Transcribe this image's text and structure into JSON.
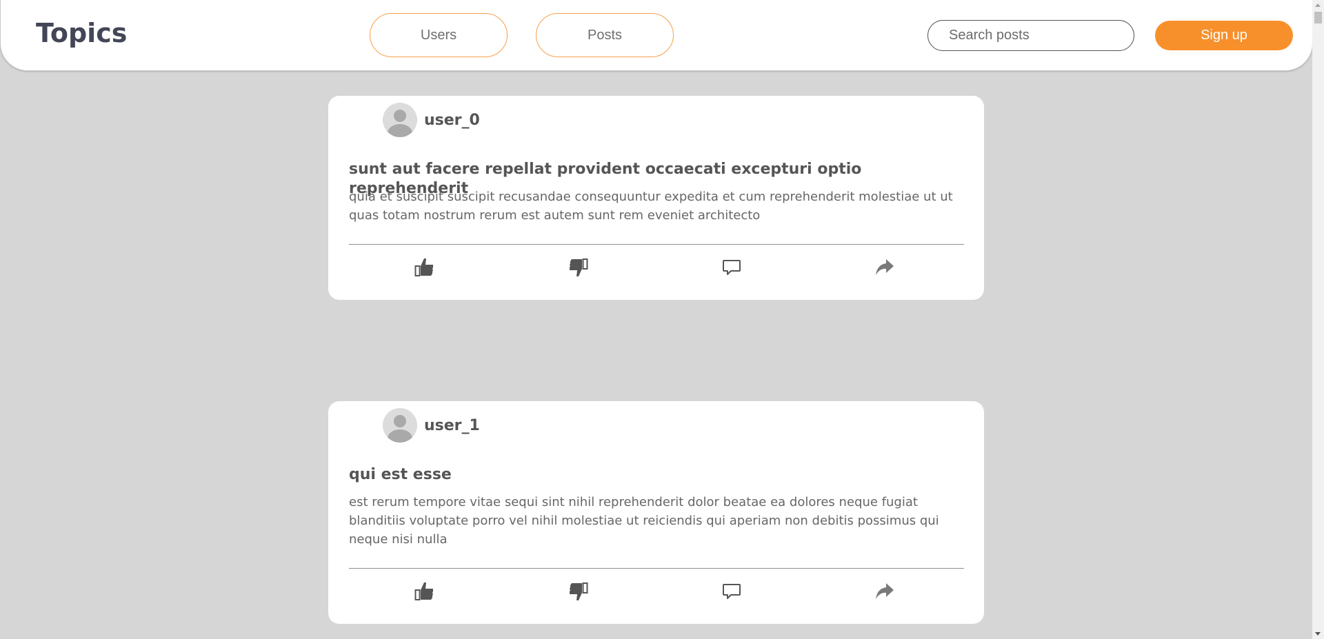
{
  "header": {
    "logo": "Topics",
    "nav": {
      "users_label": "Users",
      "posts_label": "Posts"
    },
    "search": {
      "placeholder": "Search posts",
      "value": ""
    },
    "signup_label": "Sign up"
  },
  "posts": [
    {
      "username": "user_0",
      "title": "sunt aut facere repellat provident occaecati excepturi optio reprehenderit",
      "body": "quia et suscipit suscipit recusandae consequuntur expedita et cum reprehenderit molestiae ut ut quas totam nostrum rerum est autem sunt rem eveniet architecto"
    },
    {
      "username": "user_1",
      "title": "qui est esse",
      "body": "est rerum tempore vitae sequi sint nihil reprehenderit dolor beatae ea dolores neque fugiat blanditiis voluptate porro vel nihil molestiae ut reiciendis qui aperiam non debitis possimus qui neque nisi nulla"
    }
  ],
  "actions": [
    "thumbs-up-icon",
    "thumbs-down-icon",
    "comment-icon",
    "share-icon"
  ],
  "colors": {
    "accent": "#f7902b",
    "page_background": "#d6d6d6",
    "logo": "#424656"
  }
}
